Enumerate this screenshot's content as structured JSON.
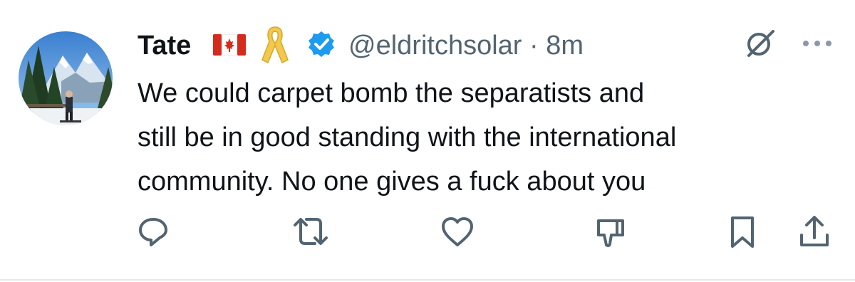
{
  "tweet": {
    "author": {
      "name": "Tate",
      "handle": "@eldritchsolar",
      "separator": "·",
      "time": "8m"
    },
    "text_lines": [
      "We could carpet bomb the separatists and",
      "still be in good standing with the international",
      "community. No one gives a fuck about you"
    ],
    "icons": {
      "flag": "canada-flag-icon",
      "ribbon": "yellow-ribbon-icon",
      "verified": "verified-badge-icon",
      "grok": "grok-icon",
      "more": "more-options-icon"
    },
    "actions": [
      "reply-icon",
      "retweet-icon",
      "like-icon",
      "downvote-icon",
      "bookmark-icon",
      "share-icon"
    ],
    "colors": {
      "text": "#0f1419",
      "muted": "#536471",
      "verified": "#1d9bf0",
      "flag_red": "#d52b1e",
      "ribbon": "#f2c94c"
    }
  }
}
